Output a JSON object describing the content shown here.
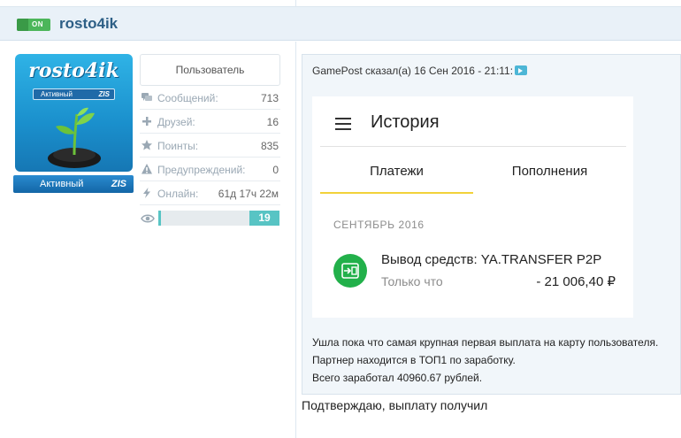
{
  "header": {
    "toggle_label": "ON",
    "username": "rosto4ik"
  },
  "profile": {
    "avatar_title": "rosto4ik",
    "avatar_status": "Активный",
    "avatar_tag": "ZIS",
    "badge_status": "Активный",
    "badge_tag": "ZIS",
    "role": "Пользователь",
    "stats": [
      {
        "icon": "messages-icon",
        "label": "Сообщений:",
        "value": "713"
      },
      {
        "icon": "plus-icon",
        "label": "Друзей:",
        "value": "16"
      },
      {
        "icon": "star-icon",
        "label": "Поинты:",
        "value": "835"
      },
      {
        "icon": "warning-icon",
        "label": "Предупреждений:",
        "value": "0"
      },
      {
        "icon": "lightning-icon",
        "label": "Онлайн:",
        "value": "61д 17ч 22м"
      }
    ],
    "reputation": {
      "icon": "eye-icon",
      "value": "19",
      "fill_fraction": 0.02
    }
  },
  "quote": {
    "header": "GamePost сказал(а) 16 Сен 2016 - 21:11:",
    "lines": [
      "Ушла пока что самая крупная первая выплата на карту пользователя.",
      "Партнер находится в ТОП1 по заработку.",
      "Всего заработал 40960.67 рублей."
    ]
  },
  "phone": {
    "title": "История",
    "tabs": [
      "Платежи",
      "Пополнения"
    ],
    "active_tab": "Платежи",
    "month": "СЕНТЯБРЬ 2016",
    "transaction": {
      "title": "Вывод средств: YA.TRANSFER P2P",
      "time": "Только что",
      "amount": "- 21 006,40 ₽"
    }
  },
  "post": {
    "text": "Подтверждаю, выплату получил"
  },
  "colors": {
    "accent_blue": "#2d5f86",
    "toggle_green": "#4cb65a",
    "tab_underline": "#f2d23a",
    "transaction_green": "#22b04a",
    "reputation_teal": "#58c4c4"
  }
}
